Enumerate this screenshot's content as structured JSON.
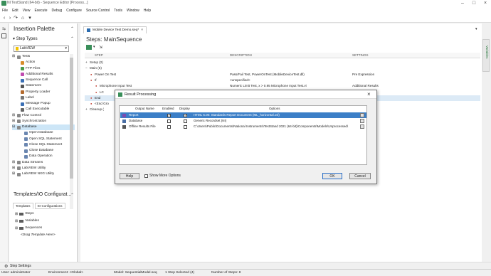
{
  "window": {
    "title": "NI TestStand (64-bit) - Sequence Editor [Process...]"
  },
  "menu": [
    "File",
    "Edit",
    "View",
    "Execute",
    "Debug",
    "Configure",
    "Source Control",
    "Tools",
    "Window",
    "Help"
  ],
  "palette": {
    "title": "Insertion Palette",
    "step_types_label": "Step Types",
    "adapter": "LabVIEW",
    "items": [
      {
        "label": "Tests",
        "expander": "+",
        "indent": 0,
        "color": "#888"
      },
      {
        "label": "Action",
        "expander": "",
        "indent": 1,
        "color": "#d98c2b"
      },
      {
        "label": "FTP Files",
        "expander": "",
        "indent": 1,
        "color": "#4a9a4a"
      },
      {
        "label": "Additional Results",
        "expander": "",
        "indent": 1,
        "color": "#c04bb0"
      },
      {
        "label": "Sequence Call",
        "expander": "",
        "indent": 1,
        "color": "#3a6fb5"
      },
      {
        "label": "Statement",
        "expander": "",
        "indent": 1,
        "color": "#555"
      },
      {
        "label": "Property Loader",
        "expander": "",
        "indent": 1,
        "color": "#b36a2e"
      },
      {
        "label": "Label",
        "expander": "",
        "indent": 1,
        "color": "#777"
      },
      {
        "label": "Message Popup",
        "expander": "",
        "indent": 1,
        "color": "#3a6fb5"
      },
      {
        "label": "Call Executable",
        "expander": "",
        "indent": 1,
        "color": "#666"
      },
      {
        "label": "Flow Control",
        "expander": "+",
        "indent": 0,
        "color": "#888"
      },
      {
        "label": "Synchronization",
        "expander": "+",
        "indent": 0,
        "color": "#888"
      },
      {
        "label": "Database",
        "expander": "-",
        "indent": 0,
        "color": "#888",
        "selected": true
      },
      {
        "label": "Open Database",
        "expander": "",
        "indent": 2,
        "color": "#6a86b0"
      },
      {
        "label": "Open SQL Statement",
        "expander": "",
        "indent": 2,
        "color": "#6a86b0"
      },
      {
        "label": "Close SQL Statement",
        "expander": "",
        "indent": 2,
        "color": "#6a86b0"
      },
      {
        "label": "Close Database",
        "expander": "",
        "indent": 2,
        "color": "#6a86b0"
      },
      {
        "label": "Data Operation",
        "expander": "",
        "indent": 2,
        "color": "#6a86b0"
      },
      {
        "label": "Data Streams",
        "expander": "+",
        "indent": 0,
        "color": "#888"
      },
      {
        "label": "LabVIEW Utility",
        "expander": "+",
        "indent": 0,
        "color": "#888"
      },
      {
        "label": "LabVIEW NXG Utility",
        "expander": "+",
        "indent": 0,
        "color": "#888"
      }
    ],
    "templates_title": "Templates/IO Configurat...",
    "tabs": [
      "Templates",
      "IO Configurations"
    ],
    "template_items": [
      "Steps",
      "Variables",
      "Sequences"
    ],
    "template_hint": "<Drag Template Here>"
  },
  "document": {
    "tab_label": "Mobile Device Test Demo.seq*",
    "steps_title": "Steps: MainSequence",
    "columns": [
      "STEP",
      "DESCRIPTION",
      "SETTINGS"
    ],
    "rows": [
      {
        "step": "Setup (2)",
        "desc": "",
        "settings": "",
        "indent": 1,
        "expander": "+"
      },
      {
        "step": "Main (5)",
        "desc": "",
        "settings": "",
        "indent": 1,
        "expander": "-"
      },
      {
        "step": "Power On Test",
        "desc": "Pass/Fail Test,  PowerOnTest (MobileDeviceTest.dll)",
        "settings": "Pre Expression",
        "indent": 2,
        "expander": ""
      },
      {
        "step": "If",
        "desc": "<unspecified>",
        "settings": "",
        "indent": 2,
        "expander": ""
      },
      {
        "step": "Microphone Input Test",
        "desc": "Numeric Limit Test,  x > 0.95  Microphone Input Test.vi",
        "settings": "Additional Results",
        "indent": 3,
        "expander": ""
      },
      {
        "step": "LC",
        "desc": "",
        "settings": "",
        "indent": 3,
        "expander": ""
      },
      {
        "step": "End",
        "desc": "",
        "settings": "",
        "indent": 2,
        "expander": "",
        "selected": true
      },
      {
        "step": "<End Gro",
        "desc": "",
        "settings": "",
        "indent": 2,
        "expander": ""
      },
      {
        "step": "Cleanup (",
        "desc": "",
        "settings": "",
        "indent": 1,
        "expander": "+"
      }
    ],
    "variables_tab": "Variables"
  },
  "dialog": {
    "title": "Result Processing",
    "columns": [
      "Output Name",
      "Enabled",
      "Display",
      "Options"
    ],
    "rows": [
      {
        "name": "Report",
        "enabled": true,
        "display": true,
        "options": "HTML 5.00: Standards Report Document (ML_horizontal.xsl)",
        "selected": true,
        "icon_color": "#7a4bb0"
      },
      {
        "name": "Database",
        "enabled": false,
        "display": false,
        "options": "Generic Recordset (NI)",
        "icon_color": "#4a6fa5"
      },
      {
        "name": "Offline Results File",
        "enabled": false,
        "display": false,
        "options": "C:\\Users\\Public\\Documents\\National Instruments\\TestStand 2021 (64-bit)\\Components\\Models\\Unprocessed\\",
        "icon_color": "#555"
      }
    ],
    "help_label": "Help",
    "show_more_label": "Show More Options",
    "ok_label": "OK",
    "cancel_label": "Cancel"
  },
  "bottom": {
    "step_settings_label": "Step Settings"
  },
  "status": {
    "user": "User: administrator",
    "environment": "Environment: <Global>",
    "model": "Model: SequentialModel.seq",
    "selected": "1 Step Selected (4)",
    "number": "Number of Steps: 8"
  }
}
